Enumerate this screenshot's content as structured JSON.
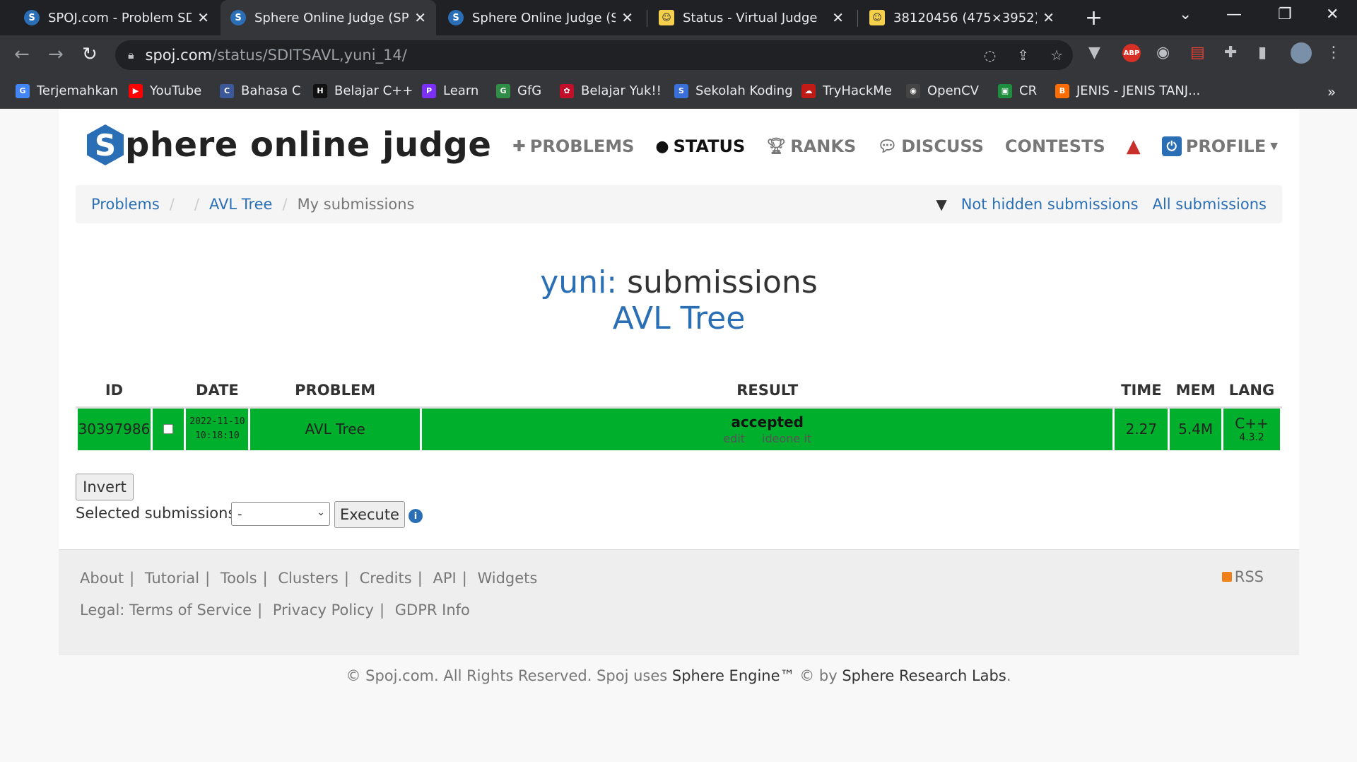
{
  "browser": {
    "tabs": [
      {
        "title": "SPOJ.com - Problem SDIT",
        "favicon": "S"
      },
      {
        "title": "Sphere Online Judge (SPC",
        "favicon": "S"
      },
      {
        "title": "Sphere Online Judge (SPC",
        "favicon": "S"
      },
      {
        "title": "Status - Virtual Judge",
        "favicon": "☺"
      },
      {
        "title": "38120456 (475×3952)",
        "favicon": "☺"
      }
    ],
    "url_domain": "spoj.com",
    "url_path": "/status/SDITSAVL,yuni_14/",
    "bookmarks": [
      {
        "label": "Terjemahkan",
        "color": "#4285f4",
        "icon": "G"
      },
      {
        "label": "YouTube",
        "color": "#ff0000",
        "icon": "▶"
      },
      {
        "label": "Bahasa C",
        "color": "#3b5998",
        "icon": "C"
      },
      {
        "label": "Belajar C++",
        "color": "#111111",
        "icon": "H"
      },
      {
        "label": "Learn",
        "color": "#7b2ff7",
        "icon": "P"
      },
      {
        "label": "GfG",
        "color": "#2f8d46",
        "icon": "G"
      },
      {
        "label": "Belajar Yuk!!",
        "color": "#c0102a",
        "icon": "✿"
      },
      {
        "label": "Sekolah Koding",
        "color": "#3a6fd8",
        "icon": "S"
      },
      {
        "label": "TryHackMe",
        "color": "#c11b17",
        "icon": "☁"
      },
      {
        "label": "OpenCV",
        "color": "#444444",
        "icon": "◉"
      },
      {
        "label": "CR",
        "color": "#1e8e3e",
        "icon": "▣"
      },
      {
        "label": "JENIS - JENIS TANJ...",
        "color": "#ff6d00",
        "icon": "B"
      }
    ]
  },
  "site": {
    "logo_letter": "S",
    "logo_text": "phere online judge",
    "nav": {
      "problems": "PROBLEMS",
      "status": "STATUS",
      "ranks": "RANKS",
      "discuss": "DISCUSS",
      "contests": "CONTESTS",
      "profile": "PROFILE"
    }
  },
  "breadcrumb": {
    "problems": "Problems",
    "problem": "AVL Tree",
    "current": "My submissions",
    "not_hidden": "Not hidden submissions",
    "all": "All submissions"
  },
  "heading": {
    "user": "yuni:",
    "rest": " submissions",
    "problem": "AVL Tree"
  },
  "table": {
    "headers": {
      "id": "ID",
      "date": "DATE",
      "problem": "PROBLEM",
      "result": "RESULT",
      "time": "TIME",
      "mem": "MEM",
      "lang": "LANG"
    },
    "rows": [
      {
        "id": "30397986",
        "date": "2022-11-10",
        "time_of_day": "10:18:10",
        "problem": "AVL Tree",
        "result": "accepted",
        "edit": "edit",
        "ideone": "ideone it",
        "time": "2.27",
        "mem": "5.4M",
        "lang": "C++",
        "lang_version": "4.3.2",
        "row_color": "#00b02c"
      }
    ]
  },
  "controls": {
    "invert": "Invert",
    "selected_label": "Selected submissions:",
    "selected_value": "-",
    "execute": "Execute"
  },
  "footer": {
    "about": "About",
    "tutorial": "Tutorial",
    "tools": "Tools",
    "clusters": "Clusters",
    "credits": "Credits",
    "api": "API",
    "widgets": "Widgets",
    "legal": "Legal:",
    "tos": "Terms of Service",
    "privacy": "Privacy Policy",
    "gdpr": "GDPR Info",
    "rss": "RSS",
    "copy_a": "© Spoj.com. All Rights Reserved. Spoj uses ",
    "copy_b": "Sphere Engine™",
    "copy_c": " © by ",
    "copy_d": "Sphere Research Labs",
    "copy_e": "."
  },
  "colors": {
    "accent": "#2a6fb6",
    "accepted": "#00b02c"
  }
}
